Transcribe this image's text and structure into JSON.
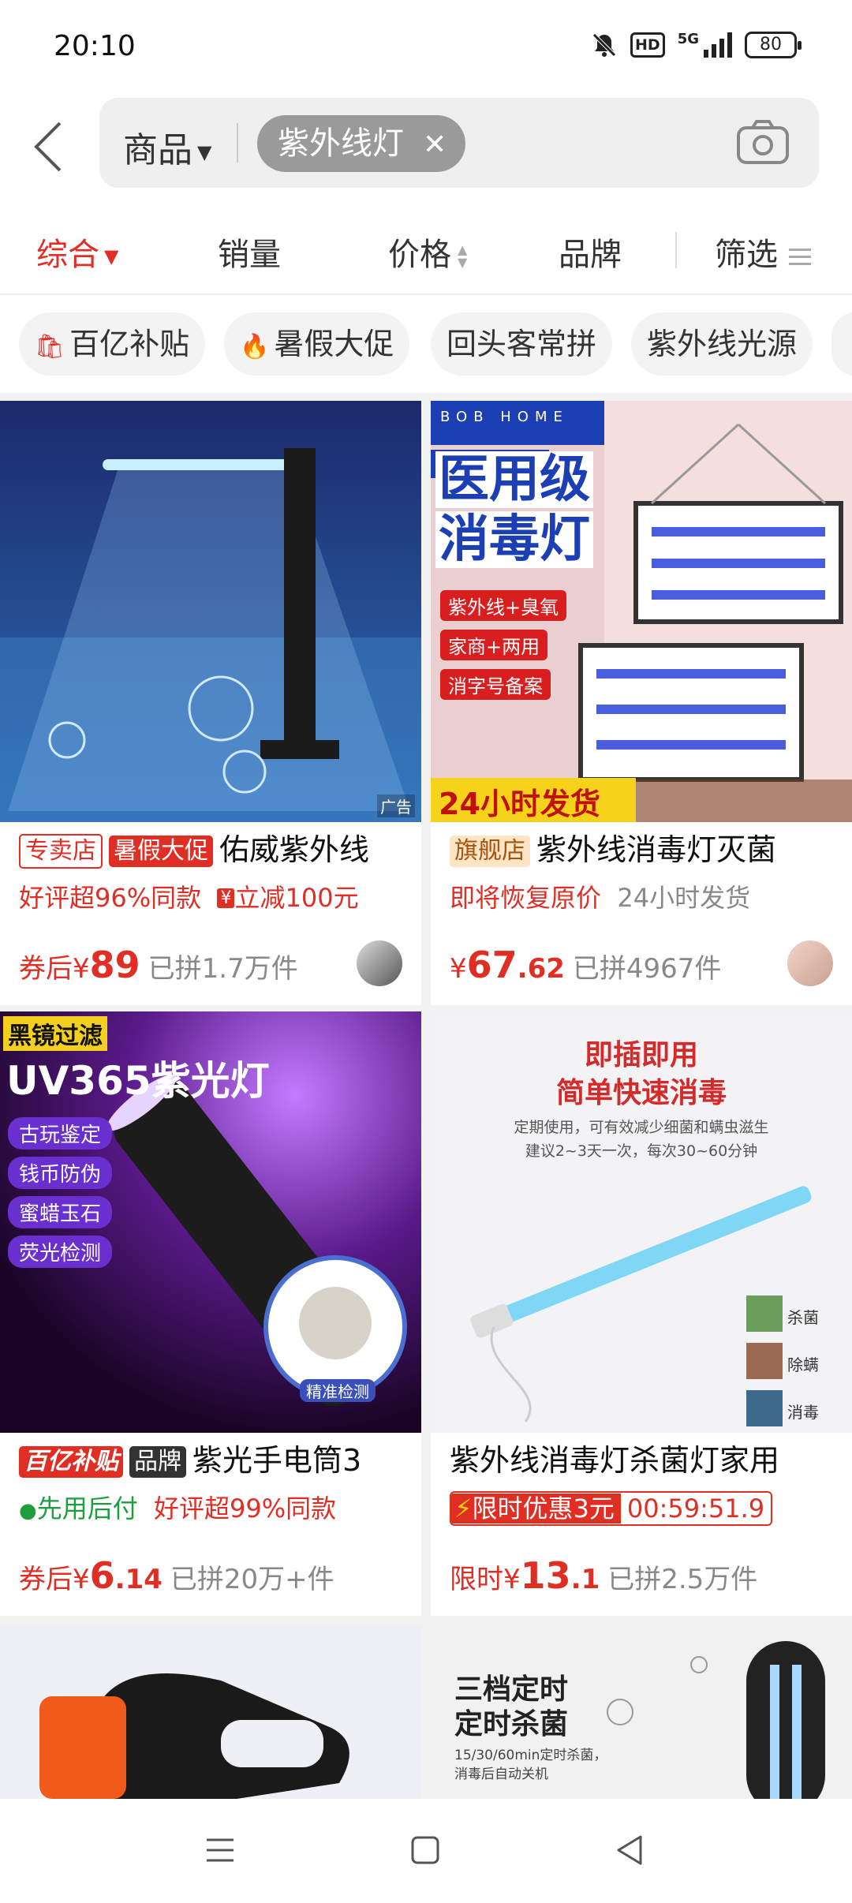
{
  "status_bar": {
    "time": "20:10",
    "network": "5G",
    "battery": "80",
    "hd_label": "HD"
  },
  "search": {
    "category": "商品",
    "chip": "紫外线灯"
  },
  "sort_tabs": [
    "综合",
    "销量",
    "价格",
    "品牌",
    "筛选"
  ],
  "filter_chips": [
    "百亿补贴",
    "暑假大促",
    "回头客常拼",
    "紫外线光源"
  ],
  "products": [
    {
      "tags": [
        "专卖店",
        "暑假大促"
      ],
      "title": "佑威紫外线",
      "sub": [
        "好评超96%同款",
        "立减100元"
      ],
      "price_prefix": "券后¥",
      "price": "89",
      "sold": "已拼1.7万件",
      "ad": "广告"
    },
    {
      "tags": [
        "旗舰店"
      ],
      "title": "紫外线消毒灯灭菌",
      "sub": [
        "即将恢复原价",
        "24小时发货"
      ],
      "price_prefix": "¥",
      "price": "67",
      "price_decimal": ".62",
      "sold": "已拼4967件",
      "image_text": {
        "brand": "BOB HOME",
        "headline1": "医用级",
        "headline2": "消毒灯",
        "badges": [
          "紫外线+臭氧",
          "家商+两用",
          "消字号备案"
        ],
        "banner": "24小时发货"
      }
    },
    {
      "tags": [
        "百亿补贴",
        "品牌"
      ],
      "title": "紫光手电筒3",
      "sub": [
        "先用后付",
        "好评超99%同款"
      ],
      "price_prefix": "券后¥",
      "price": "6",
      "price_decimal": ".14",
      "sold": "已拼20万+件",
      "image_text": {
        "corner": "黑镜过滤",
        "headline": "UV365紫光灯",
        "features": [
          "古玩鉴定",
          "钱币防伪",
          "蜜蜡玉石",
          "荧光检测"
        ],
        "badge": "精准检测"
      }
    },
    {
      "tags": [],
      "title": "紫外线消毒灯杀菌灯家用",
      "promo": "限时优惠3元",
      "countdown": "00:59:51.9",
      "price_prefix": "限时¥",
      "price": "13",
      "price_decimal": ".1",
      "sold": "已拼2.5万件",
      "image_text": {
        "headline1": "即插即用",
        "headline2": "简单快速消毒",
        "desc1": "定期使用，可有效减少细菌和螨虫滋生",
        "desc2": "建议2~3天一次，每次30~60分钟",
        "labels": [
          "杀菌",
          "除螨",
          "消毒"
        ]
      }
    },
    {
      "image_text": {}
    },
    {
      "image_text": {
        "headline1": "三档定时",
        "headline2": "定时杀菌",
        "desc1": "15/30/60min定时杀菌，",
        "desc2": "消毒后自动关机"
      }
    }
  ],
  "colors": {
    "accent": "#e02e24",
    "ink": "#222222"
  }
}
